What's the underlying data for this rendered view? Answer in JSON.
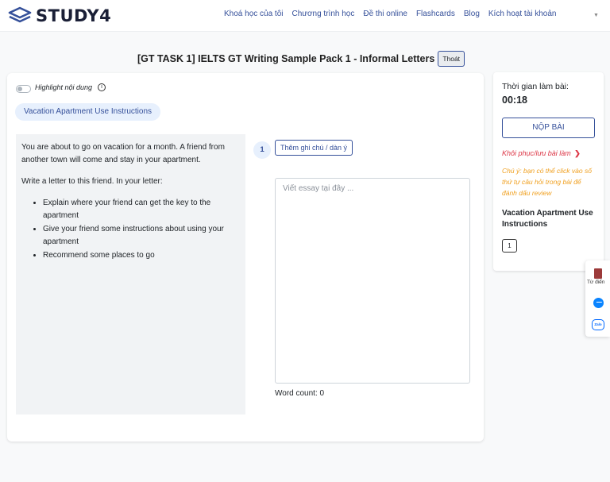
{
  "header": {
    "brand": "STUDY4",
    "nav": [
      "Khoá học của tôi",
      "Chương trình học",
      "Đề thi online",
      "Flashcards",
      "Blog",
      "Kích hoạt tài khoản"
    ]
  },
  "page": {
    "title": "[GT TASK 1] IELTS GT Writing Sample Pack 1 - Informal Letters",
    "exit_label": "Thoát"
  },
  "main": {
    "highlight_label": "Highlight nội dung",
    "info_glyph": "i",
    "section_pill": "Vacation Apartment Use Instructions",
    "prompt_paragraphs": [
      "You are about to go on vacation for a month. A friend from another town will come and stay in your apartment.",
      "Write a letter to this friend. In your letter:"
    ],
    "prompt_bullets": [
      "Explain where your friend can get the key to the apartment",
      "Give your friend some instructions about using your apartment",
      "Recommend some places to go"
    ],
    "question_number": "1",
    "note_button": "Thêm ghi chú / dàn ý",
    "essay_placeholder": "Viết essay tại đây ...",
    "word_count": "Word count: 0"
  },
  "sidebar": {
    "time_label": "Thời gian làm bài:",
    "time_value": "00:18",
    "submit_label": "NỘP BÀI",
    "restore_link": "Khôi phục/lưu bài làm",
    "restore_arrow": "❯",
    "note": "Chú ý: bạn có thể click vào số thứ tự câu hỏi trong bài để đánh dấu review",
    "section_title": "Vacation Apartment Use Instructions",
    "question_buttons": [
      "1"
    ]
  },
  "widget": {
    "dictionary_label": "Từ điển",
    "zalo_label": "Zalo"
  },
  "colors": {
    "accent": "#35509a",
    "alert": "#dc3545",
    "warning": "#f0a020",
    "pill_bg": "#e7f0fd"
  }
}
